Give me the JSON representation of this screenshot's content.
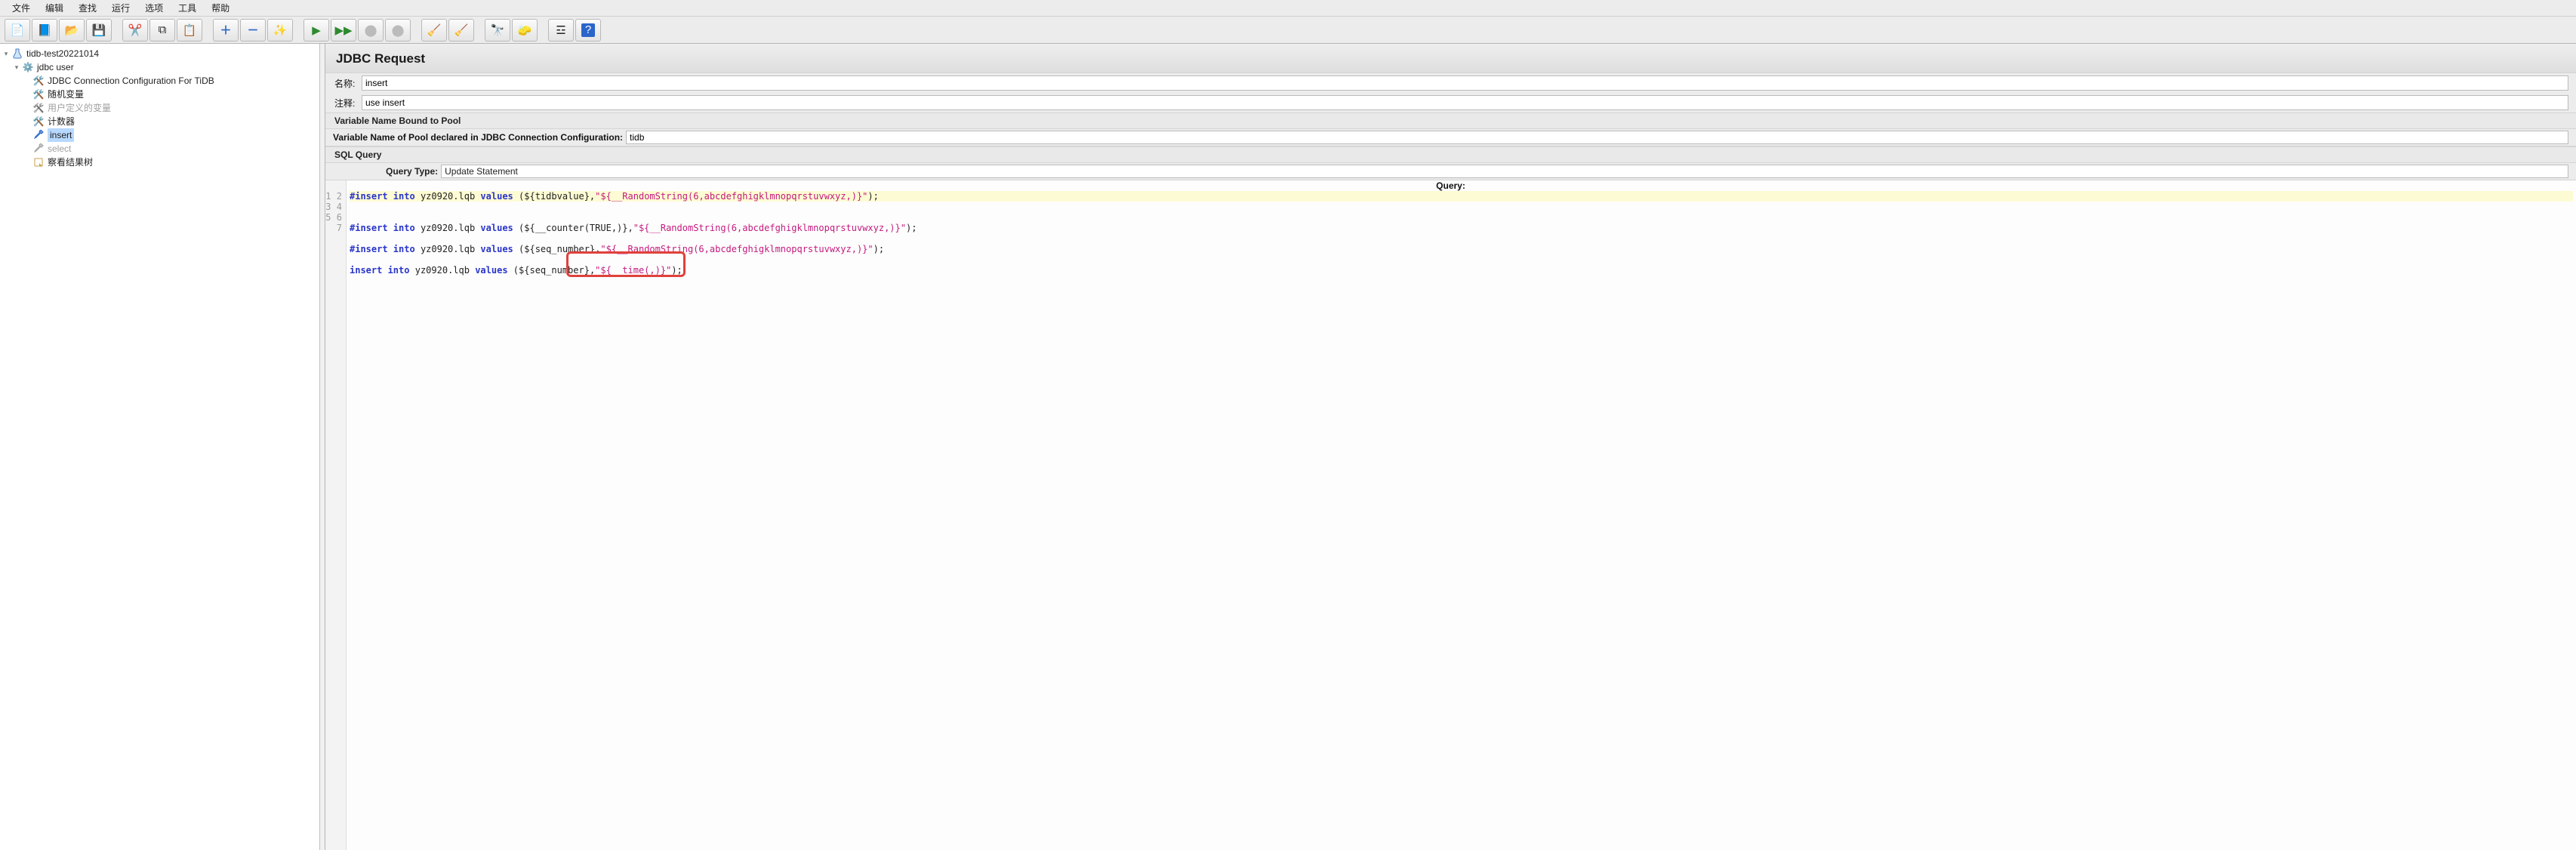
{
  "menu": {
    "file": "文件",
    "edit": "编辑",
    "search": "查找",
    "run": "运行",
    "options": "选项",
    "tools": "工具",
    "help": "帮助"
  },
  "tree": {
    "plan": "tidb-test20221014",
    "tg": "jdbc user",
    "cfg": "JDBC Connection Configuration For TiDB",
    "randvar": "随机变量",
    "userdef": "用户定义的变量",
    "counter": "计数器",
    "insert": "insert",
    "select": "select",
    "results": "察看结果树"
  },
  "request": {
    "panel_title": "JDBC Request",
    "name_label": "名称:",
    "name_value": "insert",
    "comment_label": "注释:",
    "comment_value": "use insert",
    "pool_section": "Variable Name Bound to Pool",
    "pool_label": "Variable Name of Pool declared in JDBC Connection Configuration:",
    "pool_value": "tidb",
    "sql_section": "SQL Query",
    "qt_label": "Query Type:",
    "qt_value": "Update Statement",
    "query_header": "Query:"
  },
  "code": {
    "l1": {
      "t1": "#insert into",
      "t2": "yz0920.lqb",
      "t3": "values",
      "t4": "(${tidbvalue},",
      "t5": "\"${__RandomString(6,abcdefghigklmnopqrstuvwxyz,)}\"",
      "t6": ");"
    },
    "l3": {
      "t1": "#insert into",
      "t2": "yz0920.lqb",
      "t3": "values",
      "t4": "(${__counter(TRUE,)},",
      "t5": "\"${__RandomString(6,abcdefghigklmnopqrstuvwxyz,)}\"",
      "t6": ");"
    },
    "l5": {
      "t1": "#insert into",
      "t2": "yz0920.lqb",
      "t3": "values",
      "t4": "(${seq_number},",
      "t5": "\"${__RandomString(6,abcdefghigklmnopqrstuvwxyz,)}\"",
      "t6": ");"
    },
    "l7": {
      "t1": "insert into",
      "t2": "yz0920.lqb",
      "t3": "values",
      "t4": "(${seq_number},",
      "t5": "\"${__time(,)}\"",
      "t6": ");"
    },
    "linenos": {
      "n1": "1",
      "n2": "2",
      "n3": "3",
      "n4": "4",
      "n5": "5",
      "n6": "6",
      "n7": "7"
    }
  }
}
